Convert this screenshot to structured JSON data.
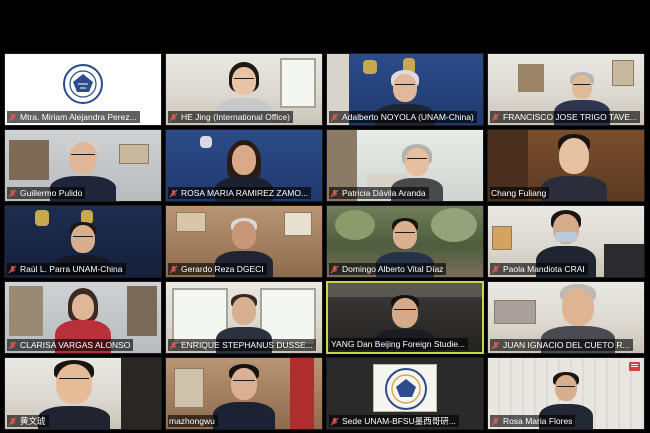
{
  "meeting": {
    "participants": [
      {
        "name": "Mtra. Miriam Alejandra Perez...",
        "muted": true,
        "scene": "logo"
      },
      {
        "name": "HE Jing (International Office)",
        "muted": true,
        "scene": "woman-office"
      },
      {
        "name": "Adalberto NOYOLA (UNAM-China)",
        "muted": true,
        "scene": "unam-backdrop"
      },
      {
        "name": "FRANCISCO JOSE TRIGO TAVE...",
        "muted": true,
        "scene": "bright-office"
      },
      {
        "name": "Guillermo Pulido",
        "muted": true,
        "scene": "office"
      },
      {
        "name": "ROSA MARIA RAMIREZ ZAMO...",
        "muted": true,
        "scene": "blue-wall"
      },
      {
        "name": "Patricia Dávila Aranda",
        "muted": true,
        "scene": "desk"
      },
      {
        "name": "Chang Fuliang",
        "muted": false,
        "scene": "bookshelf"
      },
      {
        "name": "Raúl L. Parra UNAM-China",
        "muted": true,
        "scene": "unam-backdrop"
      },
      {
        "name": "Gerardo Reza DGECI",
        "muted": true,
        "scene": "wood-office"
      },
      {
        "name": "Domingo Alberto Vital Díaz",
        "muted": true,
        "scene": "garden"
      },
      {
        "name": "Paola Mandiota CRAI",
        "muted": true,
        "scene": "mask"
      },
      {
        "name": "CLARISA VARGAS ALONSO",
        "muted": true,
        "scene": "shelves"
      },
      {
        "name": "ENRIQUE STEPHANUS DUSSE...",
        "muted": true,
        "scene": "window"
      },
      {
        "name": "YANG Dan Beijing Foreign Studie...",
        "muted": false,
        "scene": "speaker",
        "active": true
      },
      {
        "name": "JUAN IGNACIO DEL CUETO R...",
        "muted": true,
        "scene": "grey-office"
      },
      {
        "name": "黄文琥",
        "muted": true,
        "scene": "smiling"
      },
      {
        "name": "mazhongwu",
        "muted": false,
        "scene": "banner"
      },
      {
        "name": "Sede UNAM-BFSU墨西哥研...",
        "muted": true,
        "scene": "logo-dark"
      },
      {
        "name": "Rosa Maria Flores",
        "muted": true,
        "scene": "window-2",
        "badge": true
      }
    ]
  },
  "colors": {
    "mute_red": "#d2403a",
    "active_border": "#c8d64a",
    "label_bg": "rgba(0,0,0,0.62)"
  }
}
